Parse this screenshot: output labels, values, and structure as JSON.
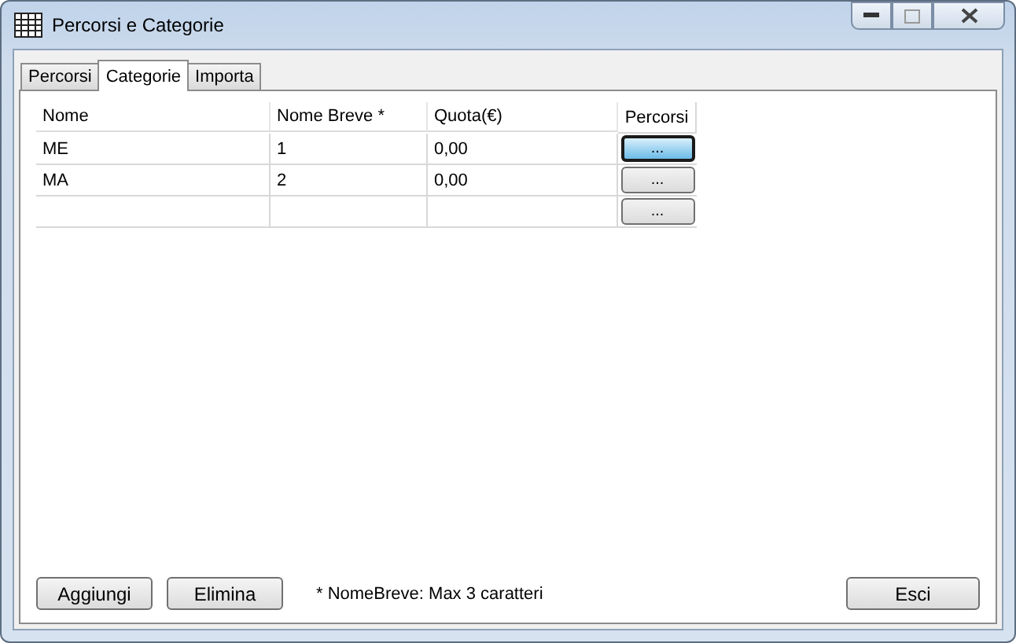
{
  "window": {
    "title": "Percorsi e Categorie"
  },
  "tabs": [
    {
      "label": "Percorsi",
      "selected": false
    },
    {
      "label": "Categorie",
      "selected": true
    },
    {
      "label": "Importa",
      "selected": false
    }
  ],
  "table": {
    "columns": [
      "Nome",
      "Nome Breve *",
      "Quota(€)",
      "Percorsi"
    ],
    "rows": [
      {
        "name": "ME",
        "short": "1",
        "quota": "0,00",
        "button": "...",
        "selected": true
      },
      {
        "name": "MA",
        "short": "2",
        "quota": "0,00",
        "button": "...",
        "selected": false
      },
      {
        "button": "...",
        "selected": false
      }
    ]
  },
  "buttons": [
    "Aggiungi",
    "Elimina"
  ],
  "note": "* NomeBreve: Max 3 caratteri",
  "exit_button": "Esci"
}
